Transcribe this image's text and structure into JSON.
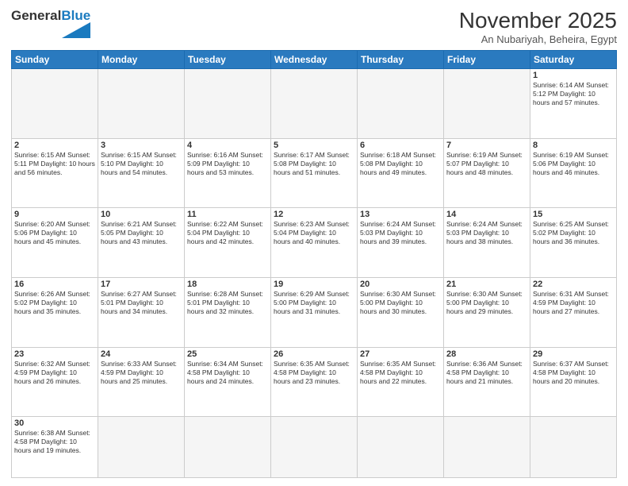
{
  "header": {
    "logo_general": "General",
    "logo_blue": "Blue",
    "month_title": "November 2025",
    "subtitle": "An Nubariyah, Beheira, Egypt"
  },
  "calendar": {
    "days_of_week": [
      "Sunday",
      "Monday",
      "Tuesday",
      "Wednesday",
      "Thursday",
      "Friday",
      "Saturday"
    ],
    "weeks": [
      [
        {
          "day": "",
          "content": ""
        },
        {
          "day": "",
          "content": ""
        },
        {
          "day": "",
          "content": ""
        },
        {
          "day": "",
          "content": ""
        },
        {
          "day": "",
          "content": ""
        },
        {
          "day": "",
          "content": ""
        },
        {
          "day": "1",
          "content": "Sunrise: 6:14 AM\nSunset: 5:12 PM\nDaylight: 10 hours\nand 57 minutes."
        }
      ],
      [
        {
          "day": "2",
          "content": "Sunrise: 6:15 AM\nSunset: 5:11 PM\nDaylight: 10 hours\nand 56 minutes."
        },
        {
          "day": "3",
          "content": "Sunrise: 6:15 AM\nSunset: 5:10 PM\nDaylight: 10 hours\nand 54 minutes."
        },
        {
          "day": "4",
          "content": "Sunrise: 6:16 AM\nSunset: 5:09 PM\nDaylight: 10 hours\nand 53 minutes."
        },
        {
          "day": "5",
          "content": "Sunrise: 6:17 AM\nSunset: 5:08 PM\nDaylight: 10 hours\nand 51 minutes."
        },
        {
          "day": "6",
          "content": "Sunrise: 6:18 AM\nSunset: 5:08 PM\nDaylight: 10 hours\nand 49 minutes."
        },
        {
          "day": "7",
          "content": "Sunrise: 6:19 AM\nSunset: 5:07 PM\nDaylight: 10 hours\nand 48 minutes."
        },
        {
          "day": "8",
          "content": "Sunrise: 6:19 AM\nSunset: 5:06 PM\nDaylight: 10 hours\nand 46 minutes."
        }
      ],
      [
        {
          "day": "9",
          "content": "Sunrise: 6:20 AM\nSunset: 5:06 PM\nDaylight: 10 hours\nand 45 minutes."
        },
        {
          "day": "10",
          "content": "Sunrise: 6:21 AM\nSunset: 5:05 PM\nDaylight: 10 hours\nand 43 minutes."
        },
        {
          "day": "11",
          "content": "Sunrise: 6:22 AM\nSunset: 5:04 PM\nDaylight: 10 hours\nand 42 minutes."
        },
        {
          "day": "12",
          "content": "Sunrise: 6:23 AM\nSunset: 5:04 PM\nDaylight: 10 hours\nand 40 minutes."
        },
        {
          "day": "13",
          "content": "Sunrise: 6:24 AM\nSunset: 5:03 PM\nDaylight: 10 hours\nand 39 minutes."
        },
        {
          "day": "14",
          "content": "Sunrise: 6:24 AM\nSunset: 5:03 PM\nDaylight: 10 hours\nand 38 minutes."
        },
        {
          "day": "15",
          "content": "Sunrise: 6:25 AM\nSunset: 5:02 PM\nDaylight: 10 hours\nand 36 minutes."
        }
      ],
      [
        {
          "day": "16",
          "content": "Sunrise: 6:26 AM\nSunset: 5:02 PM\nDaylight: 10 hours\nand 35 minutes."
        },
        {
          "day": "17",
          "content": "Sunrise: 6:27 AM\nSunset: 5:01 PM\nDaylight: 10 hours\nand 34 minutes."
        },
        {
          "day": "18",
          "content": "Sunrise: 6:28 AM\nSunset: 5:01 PM\nDaylight: 10 hours\nand 32 minutes."
        },
        {
          "day": "19",
          "content": "Sunrise: 6:29 AM\nSunset: 5:00 PM\nDaylight: 10 hours\nand 31 minutes."
        },
        {
          "day": "20",
          "content": "Sunrise: 6:30 AM\nSunset: 5:00 PM\nDaylight: 10 hours\nand 30 minutes."
        },
        {
          "day": "21",
          "content": "Sunrise: 6:30 AM\nSunset: 5:00 PM\nDaylight: 10 hours\nand 29 minutes."
        },
        {
          "day": "22",
          "content": "Sunrise: 6:31 AM\nSunset: 4:59 PM\nDaylight: 10 hours\nand 27 minutes."
        }
      ],
      [
        {
          "day": "23",
          "content": "Sunrise: 6:32 AM\nSunset: 4:59 PM\nDaylight: 10 hours\nand 26 minutes."
        },
        {
          "day": "24",
          "content": "Sunrise: 6:33 AM\nSunset: 4:59 PM\nDaylight: 10 hours\nand 25 minutes."
        },
        {
          "day": "25",
          "content": "Sunrise: 6:34 AM\nSunset: 4:58 PM\nDaylight: 10 hours\nand 24 minutes."
        },
        {
          "day": "26",
          "content": "Sunrise: 6:35 AM\nSunset: 4:58 PM\nDaylight: 10 hours\nand 23 minutes."
        },
        {
          "day": "27",
          "content": "Sunrise: 6:35 AM\nSunset: 4:58 PM\nDaylight: 10 hours\nand 22 minutes."
        },
        {
          "day": "28",
          "content": "Sunrise: 6:36 AM\nSunset: 4:58 PM\nDaylight: 10 hours\nand 21 minutes."
        },
        {
          "day": "29",
          "content": "Sunrise: 6:37 AM\nSunset: 4:58 PM\nDaylight: 10 hours\nand 20 minutes."
        }
      ],
      [
        {
          "day": "30",
          "content": "Sunrise: 6:38 AM\nSunset: 4:58 PM\nDaylight: 10 hours\nand 19 minutes."
        },
        {
          "day": "",
          "content": ""
        },
        {
          "day": "",
          "content": ""
        },
        {
          "day": "",
          "content": ""
        },
        {
          "day": "",
          "content": ""
        },
        {
          "day": "",
          "content": ""
        },
        {
          "day": "",
          "content": ""
        }
      ]
    ]
  }
}
